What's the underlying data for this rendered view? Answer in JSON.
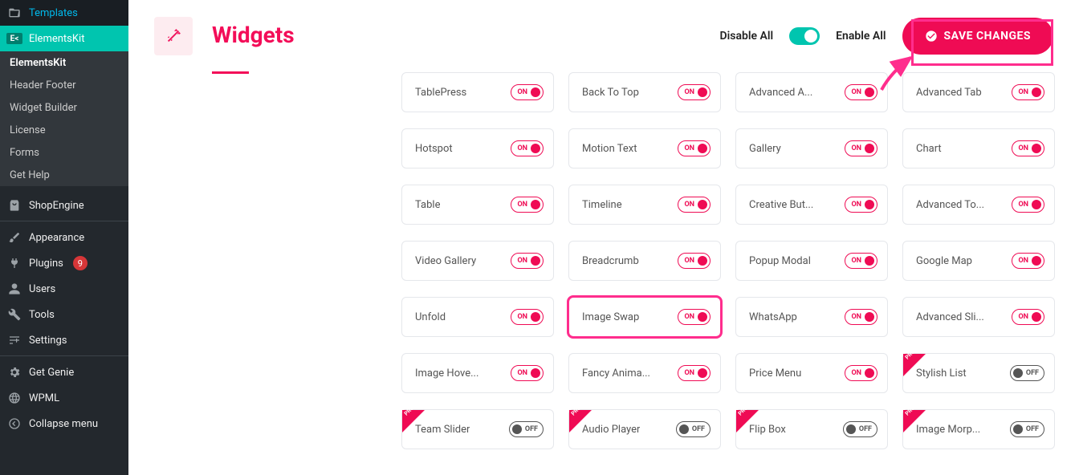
{
  "sidebar": {
    "templates": "Templates",
    "elementskit": "ElementsKit",
    "sub": {
      "elementskit": "ElementsKit",
      "header_footer": "Header Footer",
      "widget_builder": "Widget Builder",
      "license": "License",
      "forms": "Forms",
      "get_help": "Get Help"
    },
    "shopengine": "ShopEngine",
    "appearance": "Appearance",
    "plugins": "Plugins",
    "plugins_badge": "9",
    "users": "Users",
    "tools": "Tools",
    "settings": "Settings",
    "getgenie": "Get Genie",
    "wpml": "WPML",
    "collapse": "Collapse menu"
  },
  "header": {
    "title": "Widgets",
    "disable_all": "Disable All",
    "enable_all": "Enable All",
    "save": "SAVE CHANGES"
  },
  "toggle": {
    "on": "ON",
    "off": "OFF"
  },
  "ek_abbr": "E<",
  "widgets": [
    {
      "label": "TablePress",
      "state": "on",
      "pro": false,
      "hl": false
    },
    {
      "label": "Back To Top",
      "state": "on",
      "pro": false,
      "hl": false
    },
    {
      "label": "Advanced A...",
      "state": "on",
      "pro": false,
      "hl": false
    },
    {
      "label": "Advanced Tab",
      "state": "on",
      "pro": false,
      "hl": false
    },
    {
      "label": "Hotspot",
      "state": "on",
      "pro": false,
      "hl": false
    },
    {
      "label": "Motion Text",
      "state": "on",
      "pro": false,
      "hl": false
    },
    {
      "label": "Gallery",
      "state": "on",
      "pro": false,
      "hl": false
    },
    {
      "label": "Chart",
      "state": "on",
      "pro": false,
      "hl": false
    },
    {
      "label": "Table",
      "state": "on",
      "pro": false,
      "hl": false
    },
    {
      "label": "Timeline",
      "state": "on",
      "pro": false,
      "hl": false
    },
    {
      "label": "Creative But...",
      "state": "on",
      "pro": false,
      "hl": false
    },
    {
      "label": "Advanced To...",
      "state": "on",
      "pro": false,
      "hl": false
    },
    {
      "label": "Video Gallery",
      "state": "on",
      "pro": false,
      "hl": false
    },
    {
      "label": "Breadcrumb",
      "state": "on",
      "pro": false,
      "hl": false
    },
    {
      "label": "Popup Modal",
      "state": "on",
      "pro": false,
      "hl": false
    },
    {
      "label": "Google Map",
      "state": "on",
      "pro": false,
      "hl": false
    },
    {
      "label": "Unfold",
      "state": "on",
      "pro": false,
      "hl": false
    },
    {
      "label": "Image Swap",
      "state": "on",
      "pro": false,
      "hl": true
    },
    {
      "label": "WhatsApp",
      "state": "on",
      "pro": false,
      "hl": false
    },
    {
      "label": "Advanced Sli...",
      "state": "on",
      "pro": false,
      "hl": false
    },
    {
      "label": "Image Hove...",
      "state": "on",
      "pro": false,
      "hl": false
    },
    {
      "label": "Fancy Anima...",
      "state": "on",
      "pro": false,
      "hl": false
    },
    {
      "label": "Price Menu",
      "state": "on",
      "pro": false,
      "hl": false
    },
    {
      "label": "Stylish List",
      "state": "off",
      "pro": true,
      "hl": false
    },
    {
      "label": "Team Slider",
      "state": "off",
      "pro": true,
      "hl": false
    },
    {
      "label": "Audio Player",
      "state": "off",
      "pro": true,
      "hl": false
    },
    {
      "label": "Flip Box",
      "state": "off",
      "pro": true,
      "hl": false
    },
    {
      "label": "Image Morp...",
      "state": "off",
      "pro": true,
      "hl": false
    }
  ],
  "pro_label": "PRO"
}
